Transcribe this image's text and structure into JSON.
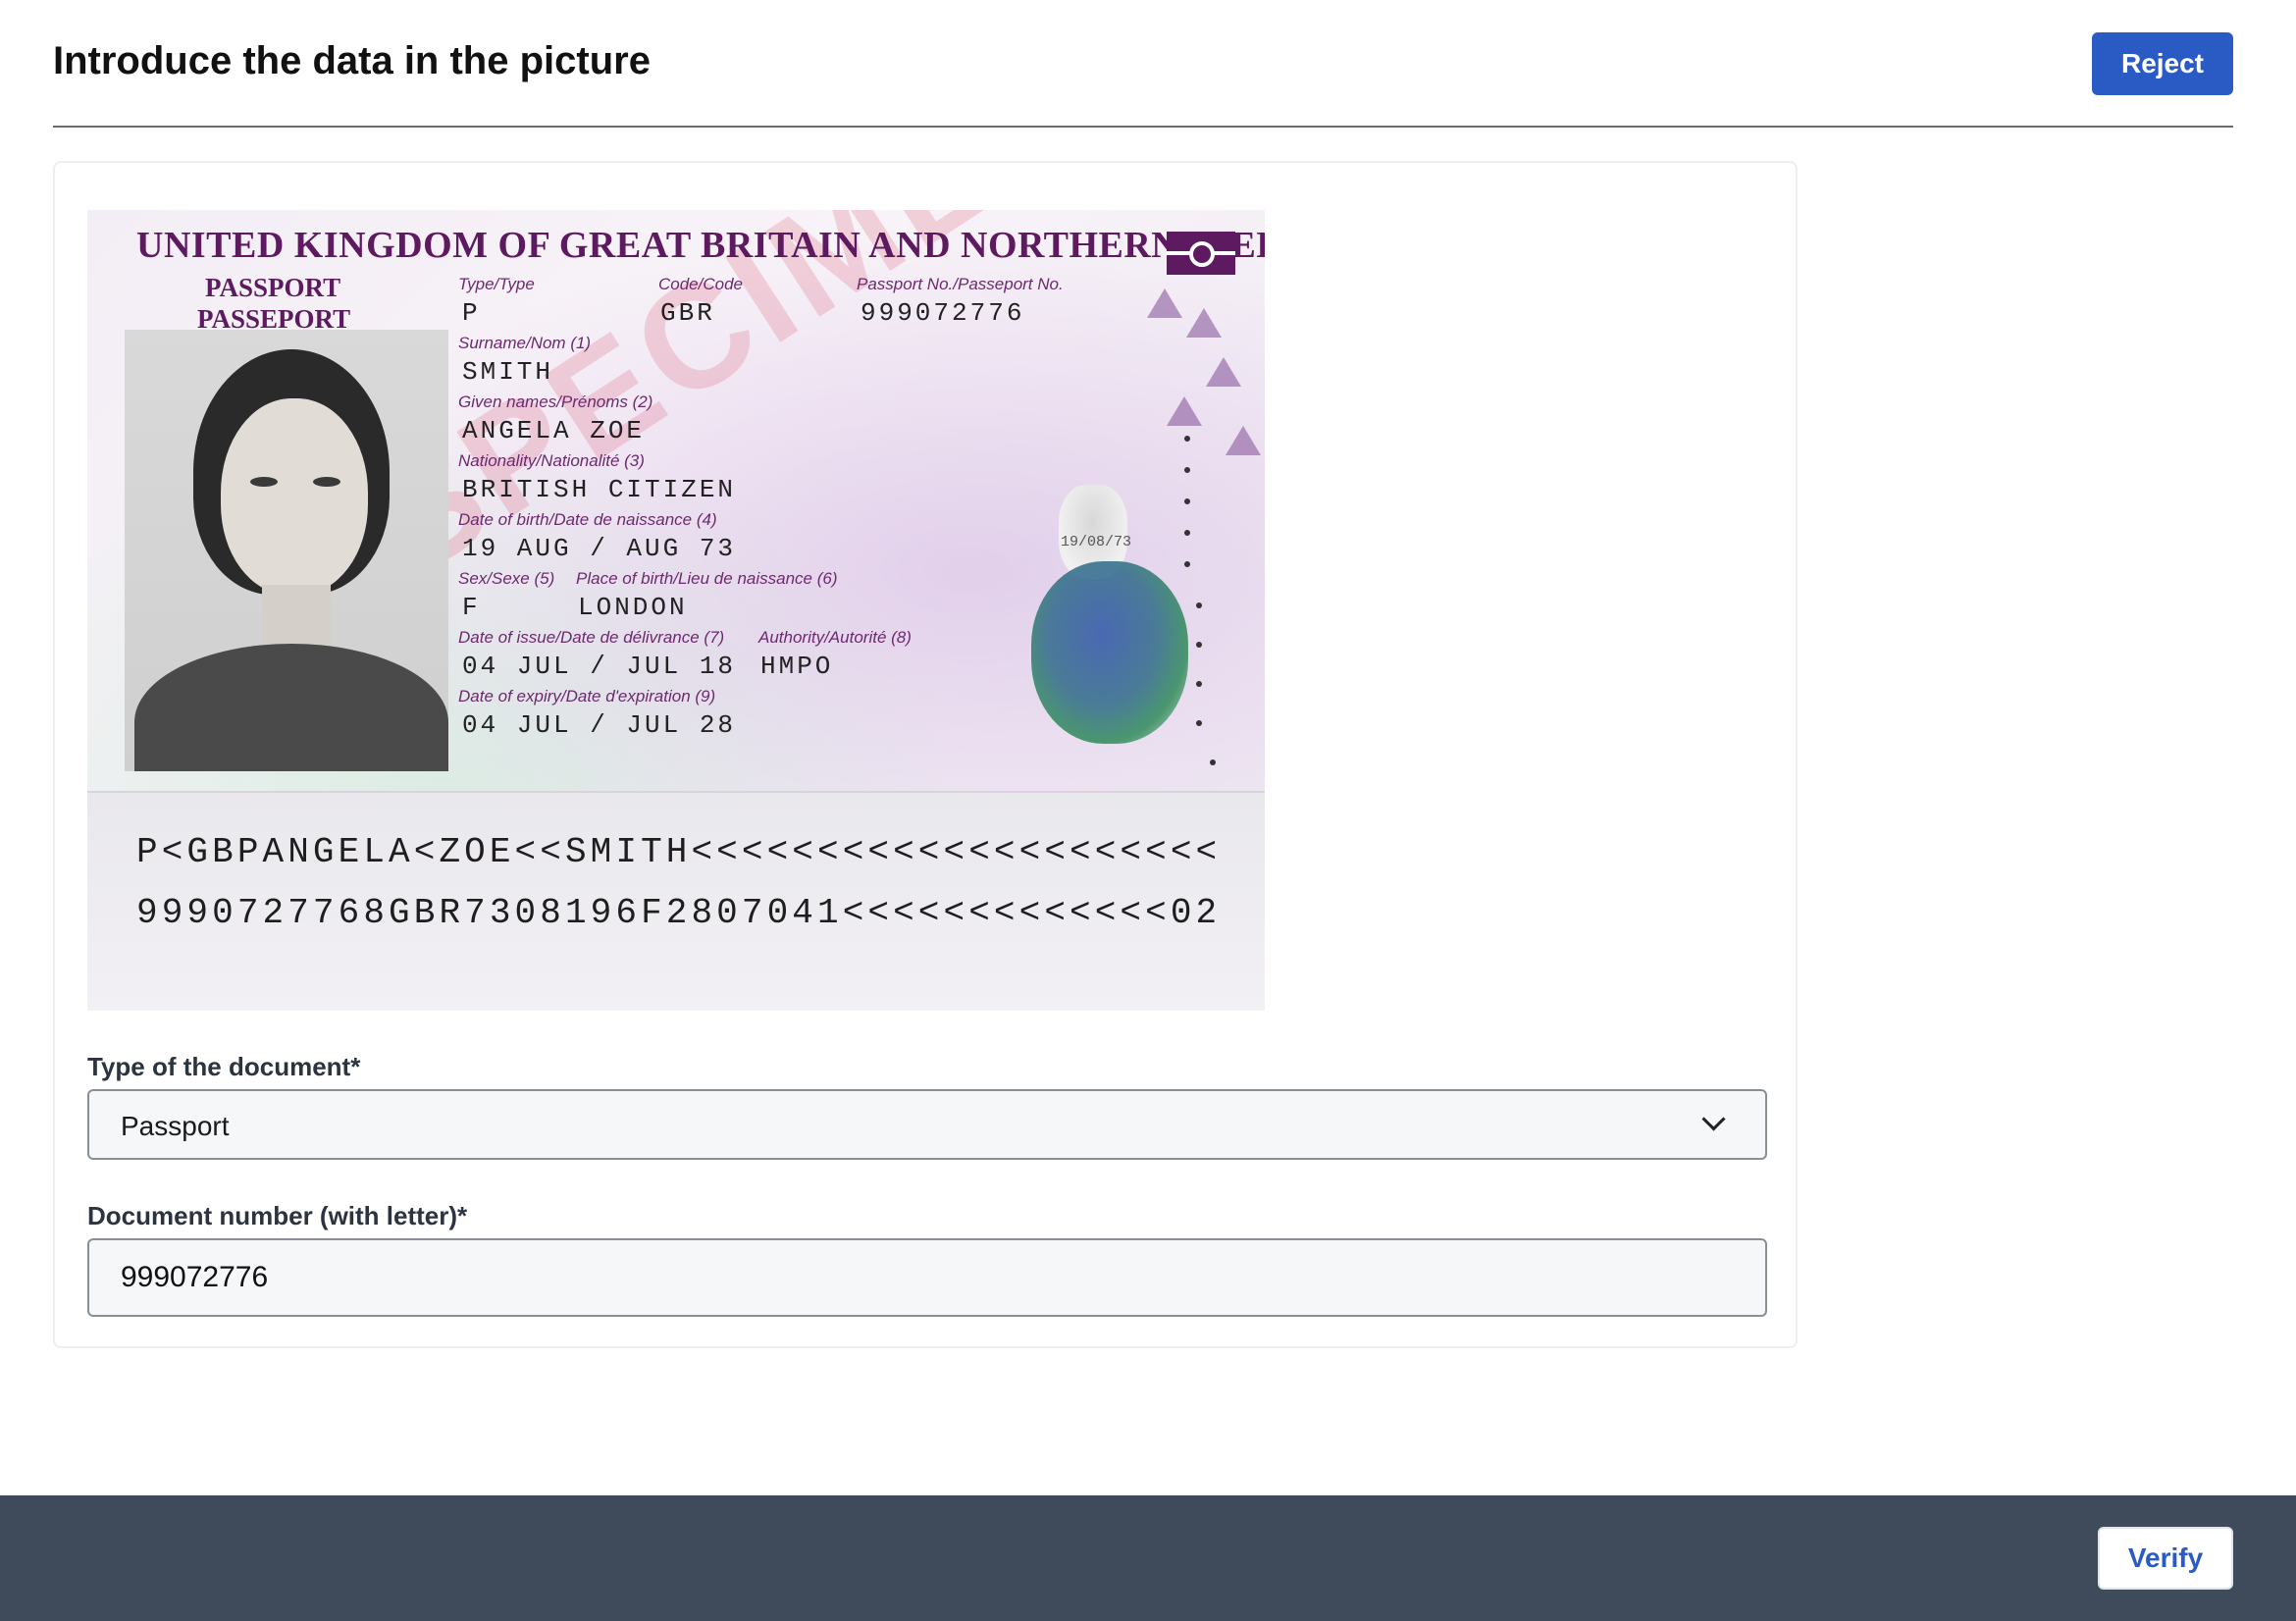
{
  "header": {
    "title": "Introduce the data in the picture",
    "reject_label": "Reject"
  },
  "passport": {
    "country_header": "UNITED KINGDOM OF GREAT BRITAIN AND NORTHERN IRELAND",
    "doc_word_en": "PASSPORT",
    "doc_word_fr": "PASSEPORT",
    "watermark": "SPECIMEN",
    "fields": {
      "type_label": "Type/Type",
      "type_value": "P",
      "code_label": "Code/Code",
      "code_value": "GBR",
      "number_label": "Passport No./Passeport No.",
      "number_value": "999072776",
      "surname_label": "Surname/Nom (1)",
      "surname_value": "SMITH",
      "given_label": "Given names/Prénoms (2)",
      "given_value": "ANGELA ZOE",
      "nationality_label": "Nationality/Nationalité (3)",
      "nationality_value": "BRITISH CITIZEN",
      "dob_label": "Date of birth/Date de naissance (4)",
      "dob_value": "19 AUG / AUG 73",
      "sex_label": "Sex/Sexe (5)",
      "sex_value": "F",
      "pob_label": "Place of birth/Lieu de naissance (6)",
      "pob_value": "LONDON",
      "issue_label": "Date of issue/Date de délivrance (7)",
      "issue_value": "04 JUL / JUL 18",
      "authority_label": "Authority/Autorité (8)",
      "authority_value": "HMPO",
      "expiry_label": "Date of expiry/Date d'expiration (9)",
      "expiry_value": "04 JUL / JUL 28"
    },
    "ghost_dob": "19/08/73",
    "mrz_line1": "P<GBPANGELA<ZOE<<SMITH<<<<<<<<<<<<<<<<<<<<<",
    "mrz_line2": "9990727768GBR7308196F2807041<<<<<<<<<<<<<02"
  },
  "form": {
    "doc_type_label": "Type of the document*",
    "doc_type_value": "Passport",
    "doc_number_label": "Document number (with letter)*",
    "doc_number_value": "999072776"
  },
  "footer": {
    "verify_label": "Verify"
  },
  "colors": {
    "primary": "#2a5bc4",
    "footer_bg": "#3f4a5a",
    "passport_accent": "#5e1a60"
  },
  "icons": {
    "select_chevron": "chevron-down-icon"
  }
}
